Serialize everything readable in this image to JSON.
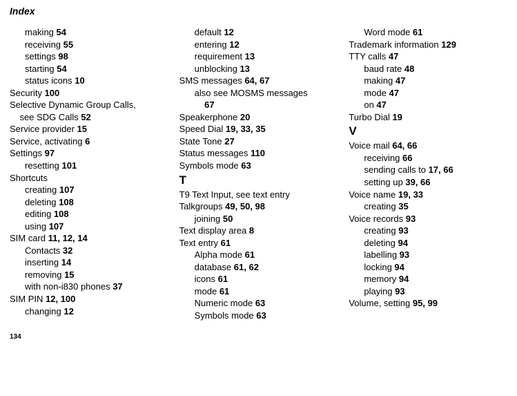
{
  "header": "Index",
  "footer": "134",
  "col1": [
    {
      "lvl": 1,
      "pre": "making ",
      "b": "54"
    },
    {
      "lvl": 1,
      "pre": "receiving ",
      "b": "55"
    },
    {
      "lvl": 1,
      "pre": "settings ",
      "b": "98"
    },
    {
      "lvl": 1,
      "pre": "starting ",
      "b": "54"
    },
    {
      "lvl": 1,
      "pre": "status icons ",
      "b": "10"
    },
    {
      "lvl": 0,
      "pre": "Security ",
      "b": "100"
    },
    {
      "lvl": 0,
      "pre": "Selective Dynamic Group Calls,\n    see SDG Calls ",
      "b": "52"
    },
    {
      "lvl": 0,
      "pre": "Service provider ",
      "b": "15"
    },
    {
      "lvl": 0,
      "pre": "Service, activating ",
      "b": "6"
    },
    {
      "lvl": 0,
      "pre": "Settings ",
      "b": "97"
    },
    {
      "lvl": 1,
      "pre": "resetting ",
      "b": "101"
    },
    {
      "lvl": 0,
      "pre": "Shortcuts",
      "b": ""
    },
    {
      "lvl": 1,
      "pre": "creating ",
      "b": "107"
    },
    {
      "lvl": 1,
      "pre": "deleting ",
      "b": "108"
    },
    {
      "lvl": 1,
      "pre": "editing ",
      "b": "108"
    },
    {
      "lvl": 1,
      "pre": "using ",
      "b": "107"
    },
    {
      "lvl": 0,
      "pre": "SIM card ",
      "b": "11, 12, 14"
    },
    {
      "lvl": 1,
      "pre": "Contacts ",
      "b": "32"
    },
    {
      "lvl": 1,
      "pre": "inserting ",
      "b": "14"
    },
    {
      "lvl": 1,
      "pre": "removing ",
      "b": "15"
    },
    {
      "lvl": 1,
      "pre": "with non-i830 phones ",
      "b": "37"
    },
    {
      "lvl": 0,
      "pre": "SIM PIN ",
      "b": "12, 100"
    },
    {
      "lvl": 1,
      "pre": "changing ",
      "b": "12"
    }
  ],
  "col2": [
    {
      "lvl": 1,
      "pre": "default ",
      "b": "12"
    },
    {
      "lvl": 1,
      "pre": "entering ",
      "b": "12"
    },
    {
      "lvl": 1,
      "pre": "requirement ",
      "b": "13"
    },
    {
      "lvl": 1,
      "pre": "unblocking ",
      "b": "13"
    },
    {
      "lvl": 0,
      "pre": "SMS messages ",
      "b": "64, 67"
    },
    {
      "lvl": 1,
      "pre": "also see MOSMS messages\n    ",
      "b": "67"
    },
    {
      "lvl": 0,
      "pre": "Speakerphone ",
      "b": "20"
    },
    {
      "lvl": 0,
      "pre": "Speed Dial ",
      "b": "19, 33, 35"
    },
    {
      "lvl": 0,
      "pre": "State Tone ",
      "b": "27"
    },
    {
      "lvl": 0,
      "pre": "Status messages ",
      "b": "110"
    },
    {
      "lvl": 0,
      "pre": "Symbols mode ",
      "b": "63"
    },
    {
      "letter": "T"
    },
    {
      "lvl": 0,
      "pre": "T9 Text Input, see text entry",
      "b": ""
    },
    {
      "lvl": 0,
      "pre": "Talkgroups ",
      "b": "49, 50, 98"
    },
    {
      "lvl": 1,
      "pre": "joining ",
      "b": "50"
    },
    {
      "lvl": 0,
      "pre": "Text display area ",
      "b": "8"
    },
    {
      "lvl": 0,
      "pre": "Text entry ",
      "b": "61"
    },
    {
      "lvl": 1,
      "pre": "Alpha mode ",
      "b": "61"
    },
    {
      "lvl": 1,
      "pre": "database ",
      "b": "61, 62"
    },
    {
      "lvl": 1,
      "pre": "icons ",
      "b": "61"
    },
    {
      "lvl": 1,
      "pre": "mode ",
      "b": "61"
    },
    {
      "lvl": 1,
      "pre": "Numeric mode ",
      "b": "63"
    },
    {
      "lvl": 1,
      "pre": "Symbols mode ",
      "b": "63"
    }
  ],
  "col3": [
    {
      "lvl": 1,
      "pre": "Word mode ",
      "b": "61"
    },
    {
      "lvl": 0,
      "pre": "Trademark information ",
      "b": "129"
    },
    {
      "lvl": 0,
      "pre": "TTY calls ",
      "b": "47"
    },
    {
      "lvl": 1,
      "pre": "baud rate ",
      "b": "48"
    },
    {
      "lvl": 1,
      "pre": "making ",
      "b": "47"
    },
    {
      "lvl": 1,
      "pre": "mode ",
      "b": "47"
    },
    {
      "lvl": 1,
      "pre": "on ",
      "b": "47"
    },
    {
      "lvl": 0,
      "pre": "Turbo Dial ",
      "b": "19"
    },
    {
      "letter": "V"
    },
    {
      "lvl": 0,
      "pre": "Voice mail ",
      "b": "64, 66"
    },
    {
      "lvl": 1,
      "pre": "receiving ",
      "b": "66"
    },
    {
      "lvl": 1,
      "pre": "sending calls to ",
      "b": "17, 66"
    },
    {
      "lvl": 1,
      "pre": "setting up ",
      "b": "39, 66"
    },
    {
      "lvl": 0,
      "pre": "Voice name ",
      "b": "19, 33"
    },
    {
      "lvl": 1,
      "pre": "creating ",
      "b": "35"
    },
    {
      "lvl": 0,
      "pre": "Voice records ",
      "b": "93"
    },
    {
      "lvl": 1,
      "pre": "creating ",
      "b": "93"
    },
    {
      "lvl": 1,
      "pre": "deleting ",
      "b": "94"
    },
    {
      "lvl": 1,
      "pre": "labelling ",
      "b": "93"
    },
    {
      "lvl": 1,
      "pre": "locking ",
      "b": "94"
    },
    {
      "lvl": 1,
      "pre": "memory ",
      "b": "94"
    },
    {
      "lvl": 1,
      "pre": "playing ",
      "b": "93"
    },
    {
      "lvl": 0,
      "pre": "Volume, setting ",
      "b": "95, 99"
    }
  ]
}
